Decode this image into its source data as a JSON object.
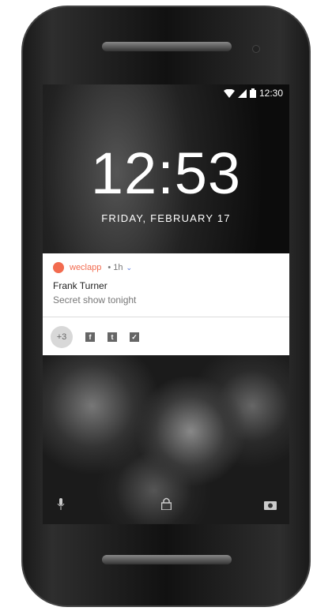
{
  "status_bar": {
    "time": "12:30"
  },
  "lockscreen": {
    "clock": "12:53",
    "date": "FRIDAY, FEBRUARY 17"
  },
  "notification": {
    "app": "weclapp",
    "time": "• 1h",
    "title": "Frank Turner",
    "body": "Secret show tonight",
    "more_count": "+3",
    "actions": [
      {
        "icon": "facebook-icon",
        "glyph": "f"
      },
      {
        "icon": "tumblr-icon",
        "glyph": "t"
      },
      {
        "icon": "twitter-icon",
        "glyph": "✓"
      }
    ]
  },
  "bottom_icons": [
    "microphone-icon",
    "lock-icon",
    "camera-icon"
  ]
}
